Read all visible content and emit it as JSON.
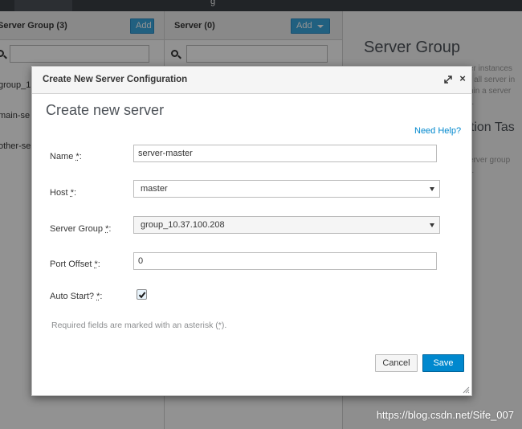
{
  "background": {
    "topbar_text": "g",
    "groups": {
      "title": "Server Group (3)",
      "add_label": "Add",
      "items": [
        "group_1",
        "main-se",
        "other-se"
      ]
    },
    "servers": {
      "title": "Server (0)",
      "add_label": "Add"
    },
    "info": {
      "title": "Server Group",
      "lines": [
        "ver instances",
        "n, all server in",
        "ithin a server",
        "nt."
      ],
      "subtitle": "ation Tas",
      "lines2": [
        "server group",
        "rs."
      ]
    },
    "watermark": "https://blog.csdn.net/Sife_007"
  },
  "modal": {
    "title": "Create New Server Configuration",
    "form_title": "Create new server",
    "help_link": "Need Help?",
    "fields": {
      "name": {
        "label": "Name",
        "value": "server-master"
      },
      "host": {
        "label": "Host",
        "value": "master"
      },
      "server_group": {
        "label": "Server Group",
        "value": "group_10.37.100.208"
      },
      "port_offset": {
        "label": "Port Offset",
        "value": "0"
      },
      "auto_start": {
        "label": "Auto Start?",
        "checked": true
      }
    },
    "required_marker": "*",
    "required_note_prefix": "Required fields are marked with an asterisk (",
    "required_note_suffix": ").",
    "cancel_label": "Cancel",
    "save_label": "Save"
  },
  "colors": {
    "primary": "#0088ce",
    "add_button": "#39a5dc",
    "topbar": "#393f44"
  }
}
